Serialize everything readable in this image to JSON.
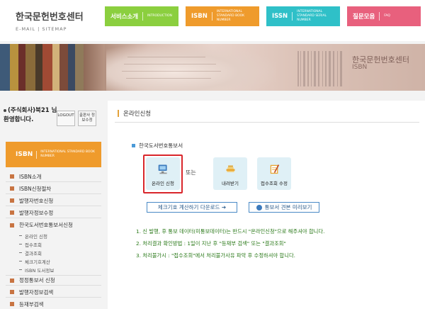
{
  "header": {
    "logo_title": "한국문헌번호센터",
    "logo_sub": "E-MAIL | SITEMAP",
    "nav": [
      {
        "label": "서비스소개",
        "sub": "INTRODUCTION",
        "color": "#8bcf3f"
      },
      {
        "label": "ISBN",
        "sub": "INTERNATIONAL STANDARD BOOK NUMBER",
        "color": "#ef9b2c"
      },
      {
        "label": "ISSN",
        "sub": "INTERNATIONAL STANDARD SERIAL NUMBER",
        "color": "#2fc0c8"
      },
      {
        "label": "질문모음",
        "sub": "FAQ",
        "color": "#e8607d"
      }
    ]
  },
  "banner": {
    "title": "한국문헌번호센터",
    "sub": "ISBN"
  },
  "sidebar": {
    "welcome": "(주식회사)북21 님 환영합니다.",
    "logout_label": "LOGOUT",
    "edit_label": "출판사 정보수정",
    "isbn_box": {
      "label": "ISBN",
      "sub": "INTERNATIONAL STANDARD BOOK NUMBER"
    },
    "menu": [
      {
        "label": "ISBN소개"
      },
      {
        "label": "ISBN신청절차"
      },
      {
        "label": "발행자번호신청"
      },
      {
        "label": "발행자정보수정"
      },
      {
        "label": "한국도서번호통보서신청"
      }
    ],
    "submenu": [
      {
        "label": "온라인 신청"
      },
      {
        "label": "접수조회"
      },
      {
        "label": "결과조회"
      },
      {
        "label": "체크기호계산"
      },
      {
        "label": "ISBN 도서정보"
      }
    ],
    "menu2": [
      {
        "label": "정정통보서 신청"
      },
      {
        "label": "발행자정보검색"
      },
      {
        "label": "등재부검색"
      }
    ]
  },
  "main": {
    "section_title": "온라인신청",
    "sub_title": "한국도서번호통보서",
    "tiles": [
      {
        "label": "온라인 신청",
        "icon": "computer-icon"
      },
      {
        "label": "내려받기",
        "icon": "download-icon"
      },
      {
        "label": "접수조회 수정",
        "icon": "pencil-icon"
      }
    ],
    "or_text": "또는",
    "calc_button": "체크기호 계산하기 다운로드 ➔",
    "preview_button": "통보서 견본 미리보기",
    "notes": [
      "1. 신 발행, 후 통보 데이터(미통보데이터)는 반드시 \"온라인신청\"으로 해주셔야 합니다.",
      "2. 처리결과 확인방법 : 1일이 지난 후 \"등재부 검색\" 또는 \"결과조회\"",
      "3. 처리불가시 : \"접수조회\"에서 처리불가사유 파악 후 수정하셔야 합니다."
    ]
  }
}
